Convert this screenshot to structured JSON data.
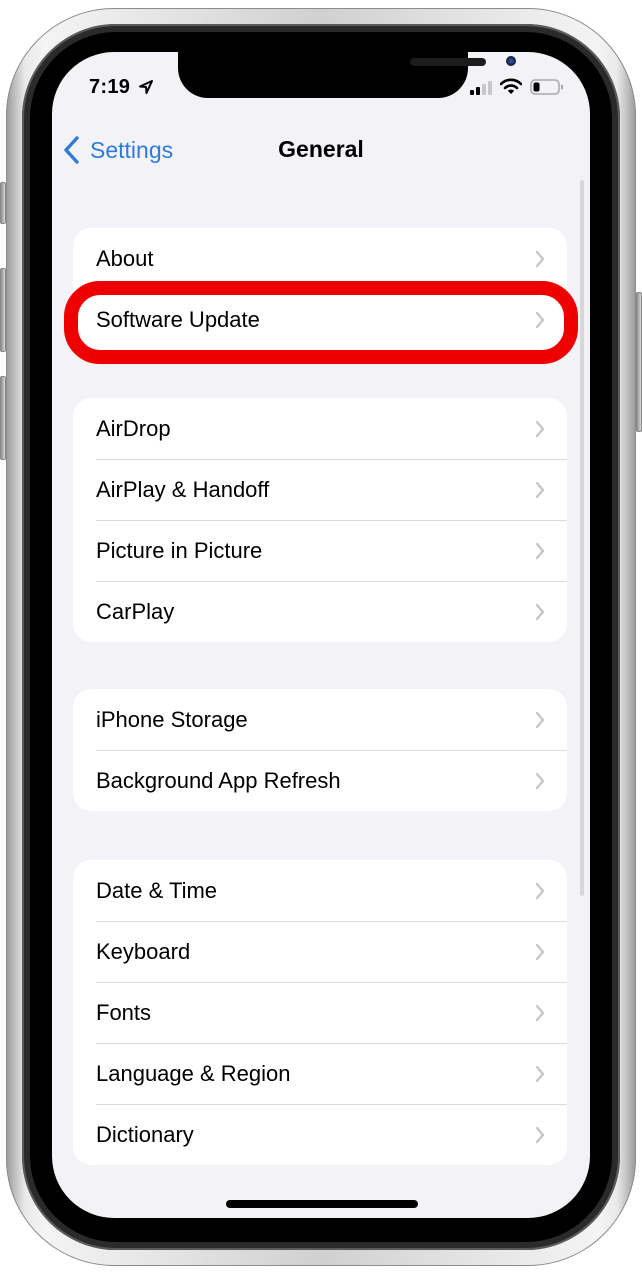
{
  "status_bar": {
    "time": "7:19",
    "icons": [
      "location-arrow-icon",
      "cellular-signal-icon",
      "wifi-icon",
      "battery-icon"
    ],
    "signal_bars_active": 2,
    "signal_bars_total": 4,
    "battery_level": 0.25
  },
  "nav": {
    "back_label": "Settings",
    "title": "General"
  },
  "groups": [
    {
      "items": [
        {
          "label": "About"
        },
        {
          "label": "Software Update",
          "highlighted": true
        }
      ]
    },
    {
      "items": [
        {
          "label": "AirDrop"
        },
        {
          "label": "AirPlay & Handoff"
        },
        {
          "label": "Picture in Picture"
        },
        {
          "label": "CarPlay"
        }
      ]
    },
    {
      "items": [
        {
          "label": "iPhone Storage"
        },
        {
          "label": "Background App Refresh"
        }
      ]
    },
    {
      "items": [
        {
          "label": "Date & Time"
        },
        {
          "label": "Keyboard"
        },
        {
          "label": "Fonts"
        },
        {
          "label": "Language & Region"
        },
        {
          "label": "Dictionary"
        }
      ]
    }
  ],
  "colors": {
    "accent": "#2f7bd8",
    "background": "#f2f2f7",
    "cell": "#ffffff",
    "separator": "#dcdce0",
    "chevron": "#c4c4c8",
    "annotation": "#ee0000"
  }
}
